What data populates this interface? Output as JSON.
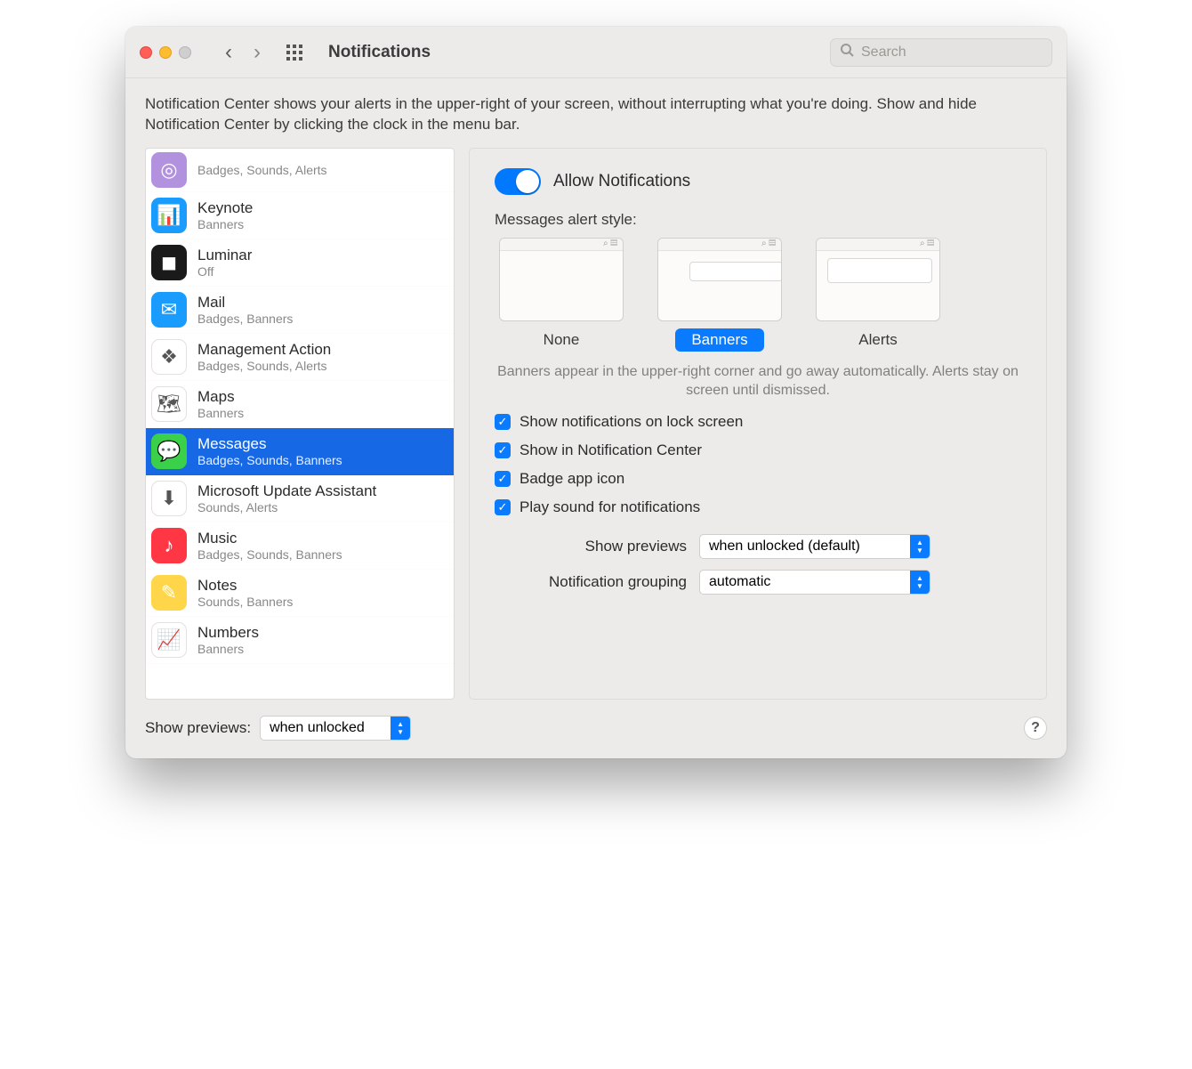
{
  "toolbar": {
    "title": "Notifications",
    "search_placeholder": "Search"
  },
  "intro": "Notification Center shows your alerts in the upper-right of your screen, without interrupting what you're doing. Show and hide Notification Center by clicking the clock in the menu bar.",
  "apps": [
    {
      "name": "",
      "sub": "Badges, Sounds, Alerts",
      "icon_bg": "#b292de",
      "glyph": "◎"
    },
    {
      "name": "Keynote",
      "sub": "Banners",
      "icon_bg": "#1a9cff",
      "glyph": "📊"
    },
    {
      "name": "Luminar",
      "sub": "Off",
      "icon_bg": "#1a1a1a",
      "glyph": "◼"
    },
    {
      "name": "Mail",
      "sub": "Badges, Banners",
      "icon_bg": "#1a9cff",
      "glyph": "✉"
    },
    {
      "name": "Management Action",
      "sub": "Badges, Sounds, Alerts",
      "icon_bg": "#ffffff",
      "glyph": "❖"
    },
    {
      "name": "Maps",
      "sub": "Banners",
      "icon_bg": "#ffffff",
      "glyph": "🗺"
    },
    {
      "name": "Messages",
      "sub": "Badges, Sounds, Banners",
      "icon_bg": "#3bd04a",
      "glyph": "💬",
      "selected": true
    },
    {
      "name": "Microsoft Update Assistant",
      "sub": "Sounds, Alerts",
      "icon_bg": "#ffffff",
      "glyph": "⬇"
    },
    {
      "name": "Music",
      "sub": "Badges, Sounds, Banners",
      "icon_bg": "#ff3644",
      "glyph": "♪"
    },
    {
      "name": "Notes",
      "sub": "Sounds, Banners",
      "icon_bg": "#ffd54a",
      "glyph": "✎"
    },
    {
      "name": "Numbers",
      "sub": "Banners",
      "icon_bg": "#ffffff",
      "glyph": "📈"
    }
  ],
  "panel": {
    "allow_label": "Allow Notifications",
    "alert_style_title": "Messages alert style:",
    "styles": [
      {
        "key": "none",
        "label": "None"
      },
      {
        "key": "banners",
        "label": "Banners",
        "selected": true
      },
      {
        "key": "alerts",
        "label": "Alerts"
      }
    ],
    "style_note": "Banners appear in the upper-right corner and go away automatically. Alerts stay on screen until dismissed.",
    "checks": [
      "Show notifications on lock screen",
      "Show in Notification Center",
      "Badge app icon",
      "Play sound for notifications"
    ],
    "show_previews_label": "Show previews",
    "show_previews_value": "when unlocked (default)",
    "grouping_label": "Notification grouping",
    "grouping_value": "automatic"
  },
  "footer": {
    "label": "Show previews:",
    "value": "when unlocked"
  }
}
